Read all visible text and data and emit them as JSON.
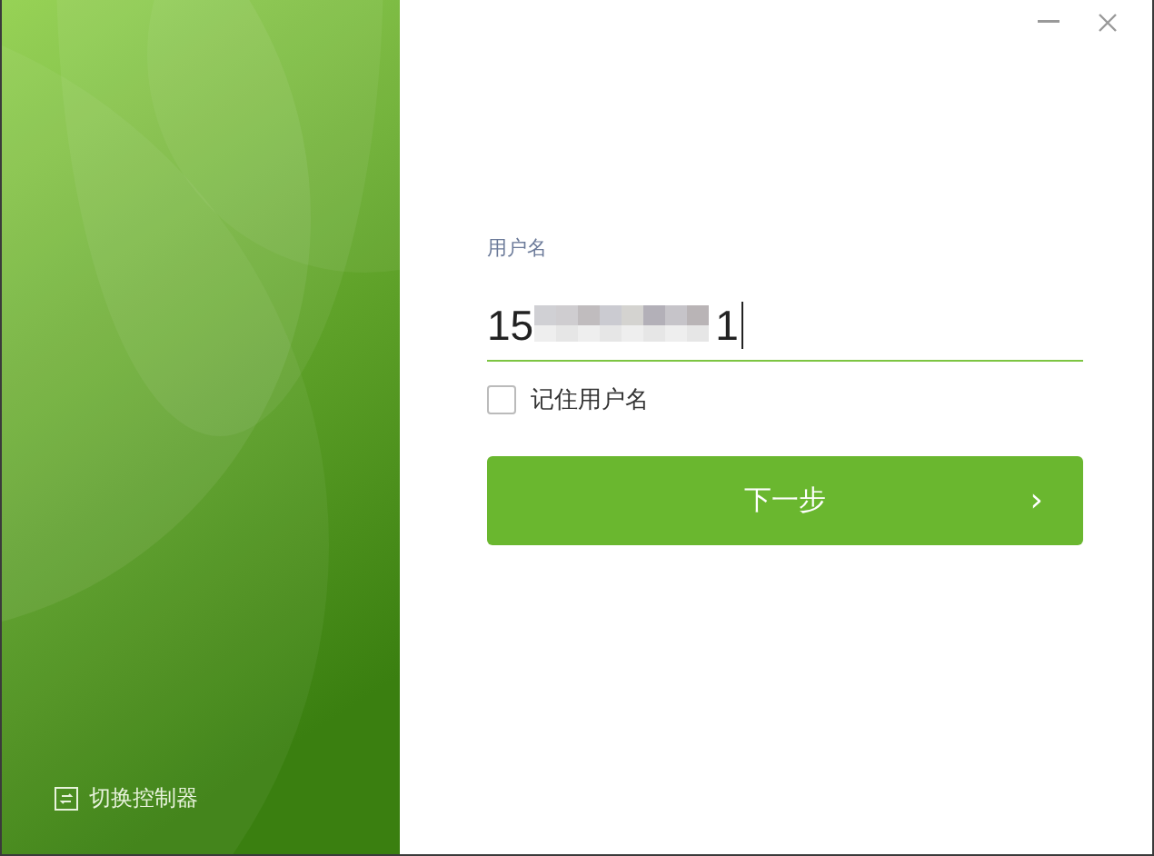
{
  "window": {
    "controls": [
      {
        "kind": "minimize"
      },
      {
        "kind": "close"
      }
    ]
  },
  "side_panel": {
    "switch_link": "切换控制器"
  },
  "form": {
    "label": "用户名",
    "value_start": "15",
    "value_end": "1",
    "value_masked": true,
    "focused": true,
    "remember": {
      "label": "记住用户名",
      "checked": false
    },
    "next_button": {
      "label": "下一步",
      "arrow": "›"
    }
  }
}
